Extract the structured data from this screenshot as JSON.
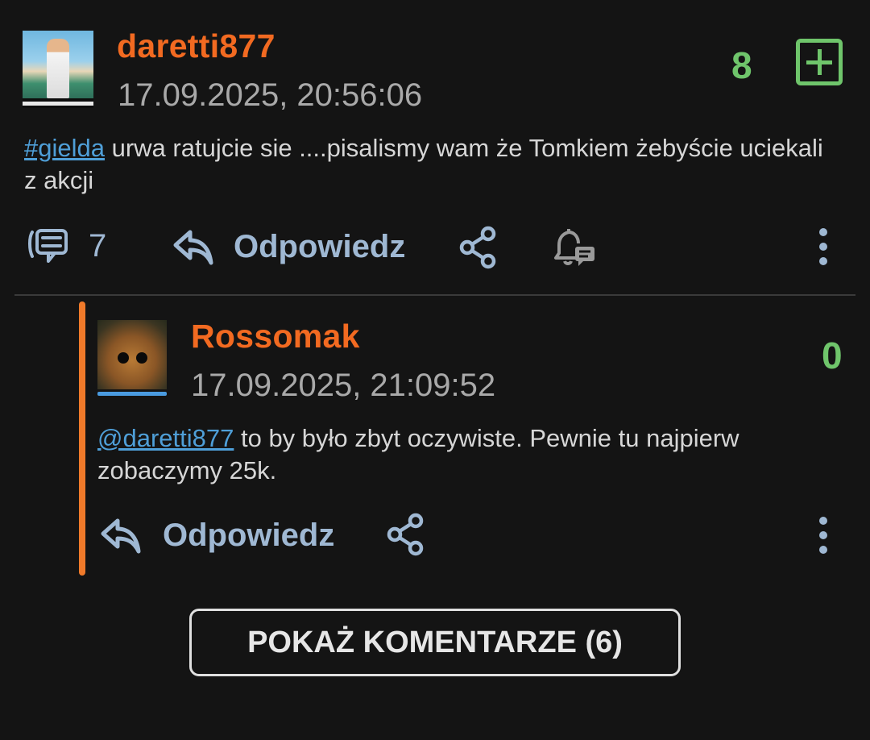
{
  "post": {
    "username": "daretti877",
    "timestamp": "17.09.2025, 20:56:06",
    "score": "8",
    "tag": "#gielda",
    "text": " urwa ratujcie sie ....pisalismy wam że Tomkiem żebyście uciekali z akcji",
    "comment_count": "7",
    "reply_label": "Odpowiedz",
    "icons": [
      "comments-icon",
      "reply-icon",
      "share-icon",
      "bell-comment-icon",
      "more-vertical-icon",
      "plus-box-icon"
    ]
  },
  "reply": {
    "username": "Rossomak",
    "timestamp": "17.09.2025, 21:09:52",
    "score": "0",
    "mention": "@daretti877",
    "text": " to by było zbyt oczywiste. Pewnie tu najpierw zobaczymy 25k.",
    "reply_label": "Odpowiedz"
  },
  "show_comments_label": "POKAŻ KOMENTARZE (6)",
  "colors": {
    "background": "#141414",
    "username": "#f26a21",
    "score": "#6fc56b",
    "link": "#4f9fd8",
    "action": "#9fb8d3",
    "thread_bar": "#f07a2a"
  }
}
